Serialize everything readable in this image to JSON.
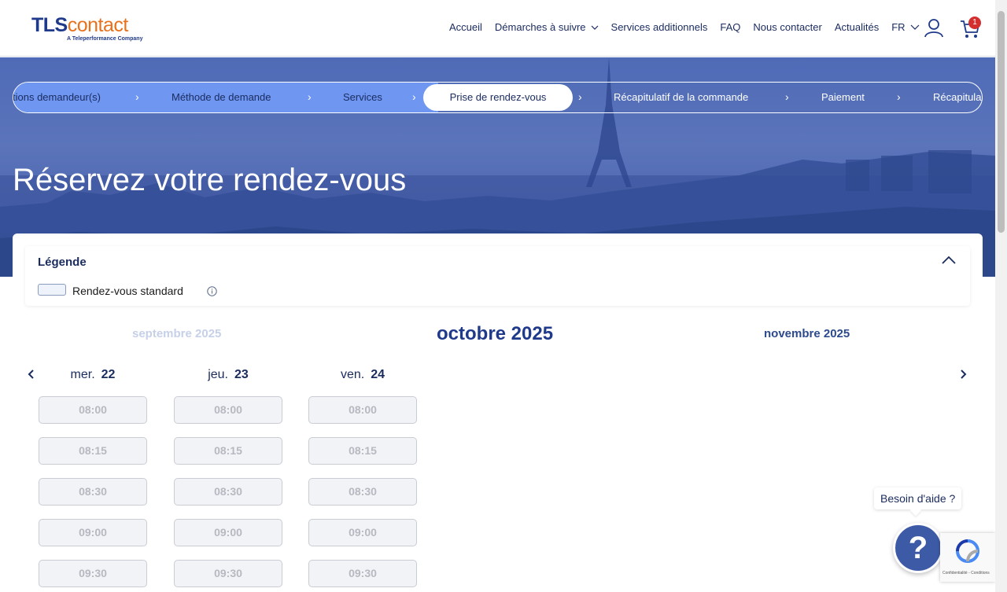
{
  "header": {
    "logo_main_a": "TLS",
    "logo_main_b": "contact",
    "logo_sub": "A Teleperformance Company",
    "nav": [
      {
        "label": "Accueil"
      },
      {
        "label": "Démarches à suivre"
      },
      {
        "label": "Services additionnels"
      },
      {
        "label": "FAQ"
      },
      {
        "label": "Nous contacter"
      },
      {
        "label": "Actualités"
      }
    ],
    "lang": "FR",
    "cart_count": "1"
  },
  "stepper": {
    "steps": [
      {
        "label": "tions demandeur(s)"
      },
      {
        "label": "Méthode de demande"
      },
      {
        "label": "Services"
      },
      {
        "label": "Prise de rendez-vous"
      },
      {
        "label": "Récapitulatif de la commande"
      },
      {
        "label": "Paiement"
      },
      {
        "label": "Récapitula"
      }
    ],
    "arrow": "›"
  },
  "hero": {
    "title": "Réservez votre rendez-vous"
  },
  "legend": {
    "title": "Légende",
    "items": [
      {
        "label": "Rendez-vous standard"
      }
    ]
  },
  "calendar": {
    "prev_month": "septembre 2025",
    "current_month": "octobre 2025",
    "next_month": "novembre 2025",
    "days": [
      {
        "name": "mer.",
        "num": "22",
        "slots": [
          "08:00",
          "08:15",
          "08:30",
          "09:00",
          "09:30"
        ]
      },
      {
        "name": "jeu.",
        "num": "23",
        "slots": [
          "08:00",
          "08:15",
          "08:30",
          "09:00",
          "09:30"
        ]
      },
      {
        "name": "ven.",
        "num": "24",
        "slots": [
          "08:00",
          "08:15",
          "08:30",
          "09:00",
          "09:30"
        ]
      }
    ]
  },
  "help": {
    "bubble": "Besoin d'aide ?",
    "icon": "?"
  },
  "recaptcha": {
    "text": "Confidentialité - Conditions"
  },
  "colors": {
    "brand_blue": "#1f3a8a",
    "brand_orange": "#e8711c",
    "step_done": "#6f97f2",
    "badge": "#d32f2f"
  }
}
